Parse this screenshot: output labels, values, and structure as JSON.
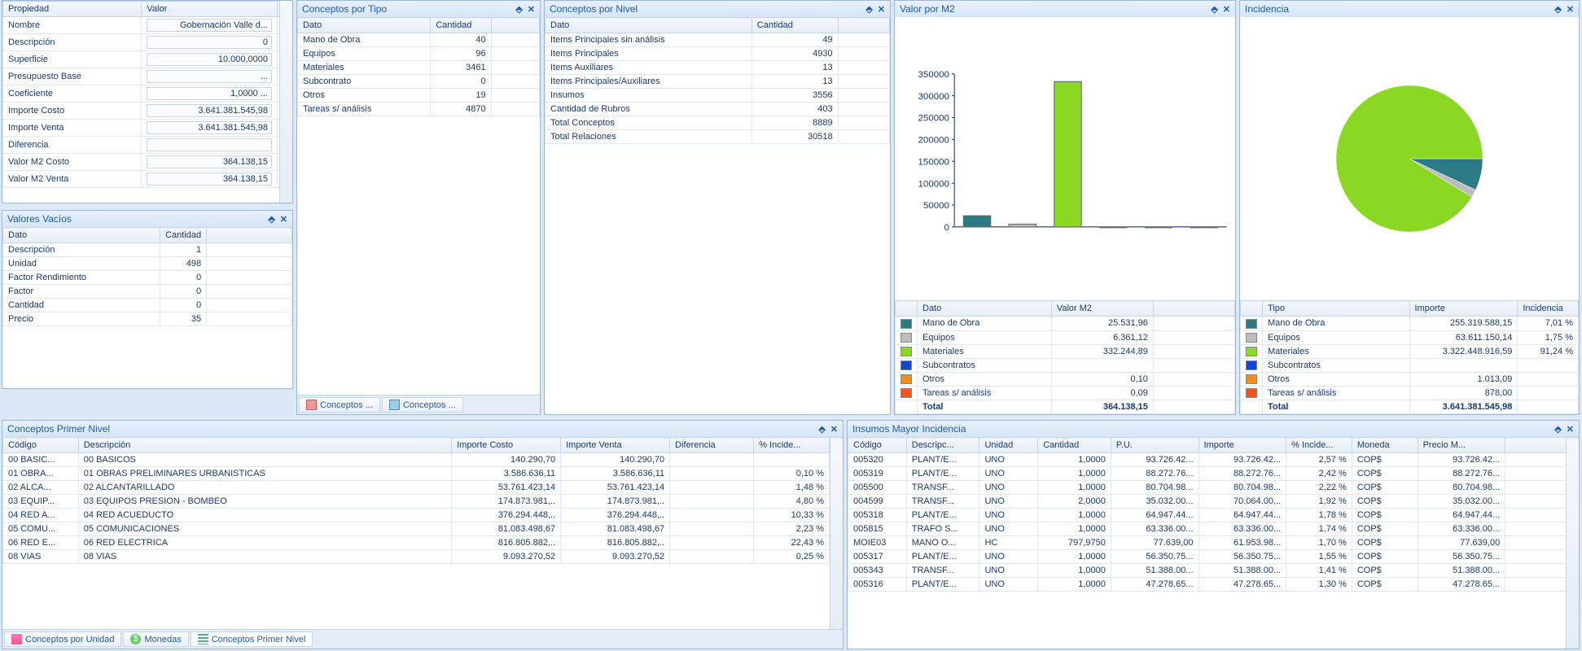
{
  "propiedades": {
    "headers": [
      "Propiedad",
      "Valor"
    ],
    "rows": [
      {
        "k": "Nombre",
        "v": "Gobernación Valle d..."
      },
      {
        "k": "Descripción",
        "v": "0"
      },
      {
        "k": "Superficie",
        "v": "10.000,0000"
      },
      {
        "k": "Presupuesto Base",
        "v": "..."
      },
      {
        "k": "Coeficiente",
        "v": "1,0000 ..."
      },
      {
        "k": "Importe Costo",
        "v": "3.641.381.545,98"
      },
      {
        "k": "Importe Venta",
        "v": "3.641.381.545,98"
      },
      {
        "k": "Diferencia",
        "v": ""
      },
      {
        "k": "Valor M2 Costo",
        "v": "364.138,15"
      },
      {
        "k": "Valor M2 Venta",
        "v": "364.138,15"
      }
    ]
  },
  "valores_vacios": {
    "title": "Valores Vacíos",
    "headers": [
      "Dato",
      "Cantidad"
    ],
    "rows": [
      {
        "k": "Descripción",
        "v": "1"
      },
      {
        "k": "Unidad",
        "v": "498"
      },
      {
        "k": "Factor Rendimiento",
        "v": "0"
      },
      {
        "k": "Factor",
        "v": "0"
      },
      {
        "k": "Cantidad",
        "v": "0"
      },
      {
        "k": "Precio",
        "v": "35"
      }
    ]
  },
  "conceptos_tipo": {
    "title": "Conceptos por Tipo",
    "headers": [
      "Dato",
      "Cantidad"
    ],
    "rows": [
      {
        "k": "Mano de Obra",
        "v": "40"
      },
      {
        "k": "Equipos",
        "v": "96"
      },
      {
        "k": "Materiales",
        "v": "3461"
      },
      {
        "k": "Subcontrato",
        "v": "0"
      },
      {
        "k": "Otros",
        "v": "19"
      },
      {
        "k": "Tareas s/ análisis",
        "v": "4870"
      }
    ],
    "tabs": [
      "Conceptos ...",
      "Conceptos ..."
    ]
  },
  "conceptos_nivel": {
    "title": "Conceptos por Nivel",
    "headers": [
      "Dato",
      "Cantidad"
    ],
    "rows": [
      {
        "k": "Items Principales sin análisis",
        "v": "49"
      },
      {
        "k": "Items Principales",
        "v": "4930"
      },
      {
        "k": "Items Auxiliares",
        "v": "13"
      },
      {
        "k": "Items Principales/Auxiliares",
        "v": "13"
      },
      {
        "k": "Insumos",
        "v": "3556"
      },
      {
        "k": "Cantidad de Rubros",
        "v": "403"
      },
      {
        "k": "Total Conceptos",
        "v": "8889"
      },
      {
        "k": "Total Relaciones",
        "v": "30518"
      }
    ]
  },
  "valor_m2": {
    "title": "Valor por M2",
    "headers": [
      "Dato",
      "Valor M2"
    ],
    "colors": [
      "#2b7a86",
      "#bdbdbd",
      "#8ad824",
      "#1247d6",
      "#f28c1a",
      "#f2541a"
    ],
    "rows": [
      {
        "k": "Mano de Obra",
        "v": "25.531,96"
      },
      {
        "k": "Equipos",
        "v": "6.361,12"
      },
      {
        "k": "Materiales",
        "v": "332.244,89"
      },
      {
        "k": "Subcontratos",
        "v": ""
      },
      {
        "k": "Otros",
        "v": "0,10"
      },
      {
        "k": "Tareas s/ análisis",
        "v": "0,09"
      }
    ],
    "total": {
      "k": "Total",
      "v": "364.138,15"
    }
  },
  "incidencia": {
    "title": "Incidencia",
    "headers": [
      "Tipo",
      "Importe",
      "Incidencia"
    ],
    "colors": [
      "#2b7a86",
      "#bdbdbd",
      "#8ad824",
      "#1247d6",
      "#f28c1a",
      "#f2541a"
    ],
    "rows": [
      {
        "k": "Mano de Obra",
        "v": "255.319.588,15",
        "p": "7,01 %"
      },
      {
        "k": "Equipos",
        "v": "63.611.150,14",
        "p": "1,75 %"
      },
      {
        "k": "Materiales",
        "v": "3.322.448.916,59",
        "p": "91,24 %"
      },
      {
        "k": "Subcontratos",
        "v": "",
        "p": ""
      },
      {
        "k": "Otros",
        "v": "1.013,09",
        "p": ""
      },
      {
        "k": "Tareas s/ análisis",
        "v": "878,00",
        "p": ""
      }
    ],
    "total": {
      "k": "Total",
      "v": "3.641.381.545,98",
      "p": ""
    }
  },
  "primer_nivel": {
    "title": "Conceptos Primer Nivel",
    "headers": [
      "Código",
      "Descripción",
      "Importe Costo",
      "Importe Venta",
      "Diferencia",
      "% Incide..."
    ],
    "rows": [
      {
        "c": "00 BASIC...",
        "d": "00 BASICOS",
        "ic": "140.290,70",
        "iv": "140.290,70",
        "df": "",
        "pi": ""
      },
      {
        "c": "01 OBRA...",
        "d": "01 OBRAS PRELIMINARES URBANISTICAS",
        "ic": "3.586.636,11",
        "iv": "3.586.636,11",
        "df": "",
        "pi": "0,10 %"
      },
      {
        "c": "02 ALCA...",
        "d": "02 ALCANTARILLADO",
        "ic": "53.761.423,14",
        "iv": "53.761.423,14",
        "df": "",
        "pi": "1,48 %"
      },
      {
        "c": "03 EQUIP...",
        "d": "03 EQUIPOS PRESION - BOMBEO",
        "ic": "174.873.981,..",
        "iv": "174.873.981,..",
        "df": "",
        "pi": "4,80 %"
      },
      {
        "c": "04 RED A...",
        "d": "04 RED ACUEDUCTO",
        "ic": "376.294.448,..",
        "iv": "376.294.448,..",
        "df": "",
        "pi": "10,33 %"
      },
      {
        "c": "05 COMU...",
        "d": "05 COMUNICACIONES",
        "ic": "81.083.498,67",
        "iv": "81.083.498,67",
        "df": "",
        "pi": "2,23 %"
      },
      {
        "c": "06 RED E...",
        "d": "06 RED ELECTRICA",
        "ic": "816.805.882,..",
        "iv": "816.805.882,..",
        "df": "",
        "pi": "22,43 %"
      },
      {
        "c": "08 VIAS",
        "d": "08 VIAS",
        "ic": "9.093.270,52",
        "iv": "9.093.270,52",
        "df": "",
        "pi": "0,25 %"
      }
    ],
    "tabs": [
      "Conceptos por Unidad",
      "Monedas",
      "Conceptos Primer Nivel"
    ]
  },
  "insumos": {
    "title": "Insumos Mayor Incidencia",
    "headers": [
      "Código",
      "Descripc...",
      "Unidad",
      "Cantidad",
      "P.U.",
      "Importe",
      "% Incide...",
      "Moneda",
      "Precio M..."
    ],
    "rows": [
      {
        "c": "005320",
        "d": "PLANT/E...",
        "u": "UNO",
        "q": "1,0000",
        "pu": "93.726.42...",
        "im": "93.726.42...",
        "pi": "2,57 %",
        "m": "COP$",
        "pm": "93.726.42..."
      },
      {
        "c": "005319",
        "d": "PLANT/E...",
        "u": "UNO",
        "q": "1,0000",
        "pu": "88.272.76...",
        "im": "88.272.76...",
        "pi": "2,42 %",
        "m": "COP$",
        "pm": "88.272.76..."
      },
      {
        "c": "005500",
        "d": "TRANSF...",
        "u": "UNO",
        "q": "1,0000",
        "pu": "80.704.98...",
        "im": "80.704.98...",
        "pi": "2,22 %",
        "m": "COP$",
        "pm": "80.704.98..."
      },
      {
        "c": "004599",
        "d": "TRANSF...",
        "u": "UNO",
        "q": "2,0000",
        "pu": "35.032.00...",
        "im": "70.064.00...",
        "pi": "1,92 %",
        "m": "COP$",
        "pm": "35.032.00..."
      },
      {
        "c": "005318",
        "d": "PLANT/E...",
        "u": "UNO",
        "q": "1,0000",
        "pu": "64.947.44...",
        "im": "64.947.44...",
        "pi": "1,78 %",
        "m": "COP$",
        "pm": "64.947.44..."
      },
      {
        "c": "005815",
        "d": "TRAFO S...",
        "u": "UNO",
        "q": "1,0000",
        "pu": "63.336.00...",
        "im": "63.336.00...",
        "pi": "1,74 %",
        "m": "COP$",
        "pm": "63.336.00..."
      },
      {
        "c": "MOIE03",
        "d": "MANO O...",
        "u": "HC",
        "q": "797,9750",
        "pu": "77.639,00",
        "im": "61.953.98...",
        "pi": "1,70 %",
        "m": "COP$",
        "pm": "77.639,00"
      },
      {
        "c": "005317",
        "d": "PLANT/E...",
        "u": "UNO",
        "q": "1,0000",
        "pu": "56.350.75...",
        "im": "56.350.75...",
        "pi": "1,55 %",
        "m": "COP$",
        "pm": "56.350.75..."
      },
      {
        "c": "005343",
        "d": "TRANSF...",
        "u": "UNO",
        "q": "1,0000",
        "pu": "51.388.00...",
        "im": "51.388.00...",
        "pi": "1,41 %",
        "m": "COP$",
        "pm": "51.388.00..."
      },
      {
        "c": "005316",
        "d": "PLANT/E...",
        "u": "UNO",
        "q": "1,0000",
        "pu": "47.278.65...",
        "im": "47.278.65...",
        "pi": "1,30 %",
        "m": "COP$",
        "pm": "47.278.65..."
      }
    ]
  },
  "chart_data": [
    {
      "type": "bar",
      "title": "Valor por M2",
      "categories": [
        "Mano de Obra",
        "Equipos",
        "Materiales",
        "Subcontratos",
        "Otros",
        "Tareas s/ análisis"
      ],
      "values": [
        25531.96,
        6361.12,
        332244.89,
        0,
        0.1,
        0.09
      ],
      "colors": [
        "#2b7a86",
        "#bdbdbd",
        "#8ad824",
        "#1247d6",
        "#f28c1a",
        "#f2541a"
      ],
      "ylim": [
        0,
        350000
      ],
      "yticks": [
        0,
        50000,
        100000,
        150000,
        200000,
        250000,
        300000,
        350000
      ],
      "xlabel": "",
      "ylabel": ""
    },
    {
      "type": "pie",
      "title": "Incidencia",
      "categories": [
        "Mano de Obra",
        "Equipos",
        "Materiales",
        "Subcontratos",
        "Otros",
        "Tareas s/ análisis"
      ],
      "values": [
        7.01,
        1.75,
        91.24,
        0,
        0,
        0
      ],
      "colors": [
        "#2b7a86",
        "#bdbdbd",
        "#8ad824",
        "#1247d6",
        "#f28c1a",
        "#f2541a"
      ]
    }
  ]
}
